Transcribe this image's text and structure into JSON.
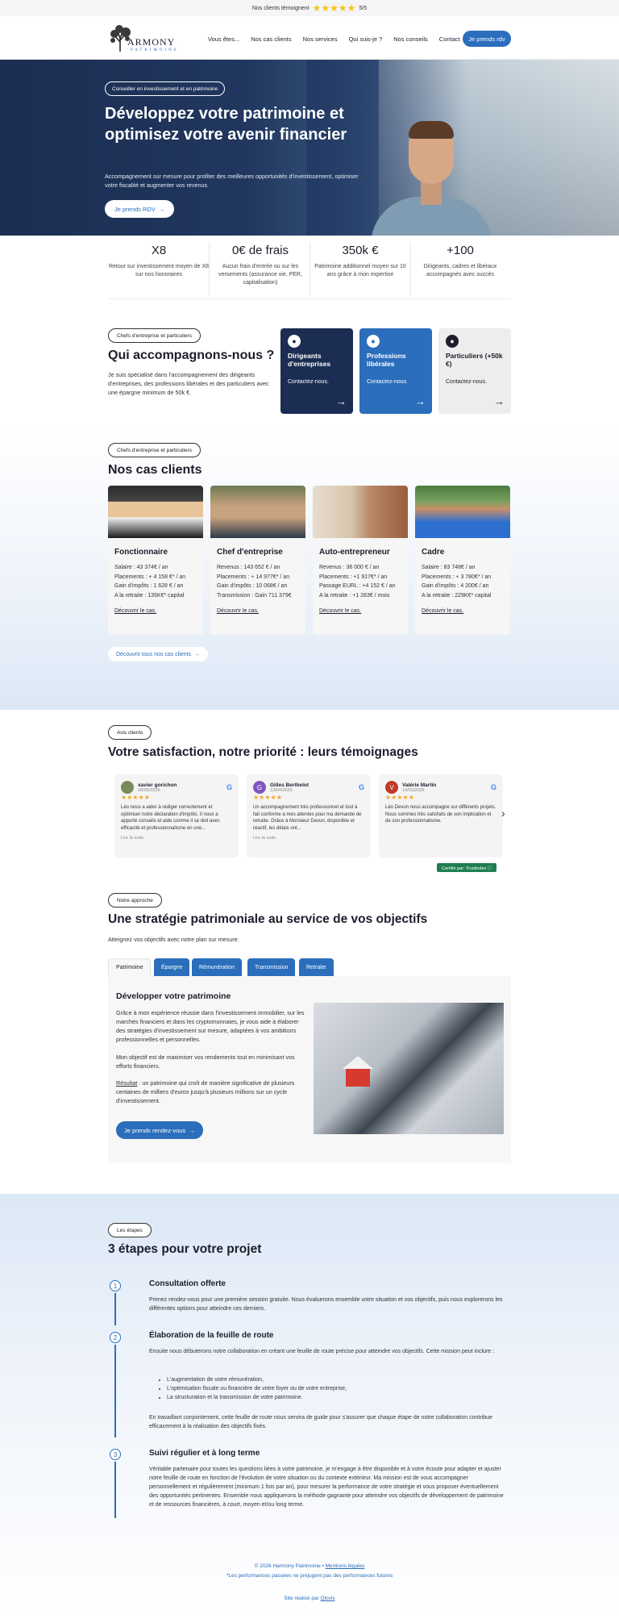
{
  "topbar": {
    "label": "Nos clients témoignent",
    "stars": "★★★★★",
    "score": "5/5"
  },
  "nav": {
    "logo_main": "ARMONY",
    "logo_sub": "PATRIMOINE",
    "links": [
      "Vous êtes...",
      "Nos cas clients",
      "Nos services",
      "Qui suis-je ?",
      "Nos conseils",
      "Contact"
    ],
    "cta": "Je prends rdv"
  },
  "hero": {
    "badge": "Conseiller en investissement et en patrimoine",
    "title": "Développez votre patrimoine et optimisez votre avenir financier",
    "subtitle": "Accompagnement sur mesure pour profiter des meilleures opportunités d'investissement, optimiser votre fiscalité et augmenter vos revenus.",
    "cta": "Je prends RDV",
    "arrow": "→"
  },
  "stats": [
    {
      "value": "X8",
      "desc": "Retour sur investissement moyen de X8 sur nos honoraires"
    },
    {
      "value": "0€ de frais",
      "desc": "Aucun frais d'entrée ou sur les versements (assurance vie, PER, capitalisation)"
    },
    {
      "value": "350k €",
      "desc": "Patrimoine additionnel moyen sur 10 ans grâce à mon expertise"
    },
    {
      "value": "+100",
      "desc": "Dirigeants, cadres et libéraux accompagnés avec succès"
    }
  ],
  "accompany": {
    "pill": "Chefs d'entreprise et particuliers",
    "title": "Qui accompagnons-nous ?",
    "text": "Je suis spécialisé dans l'accompagnement des dirigeants d'entreprises, des professions libérales et des particuliers avec une épargne minimum de 50k €.",
    "cards": [
      {
        "title": "Dirigeants d'entreprises",
        "link": "Contactez-nous.",
        "arrow": "→"
      },
      {
        "title": "Professions libérales",
        "link": "Contactez-nous.",
        "arrow": "→"
      },
      {
        "title": "Particuliers (+50k €)",
        "link": "Contactez-nous.",
        "arrow": "→"
      }
    ]
  },
  "cases": {
    "pill": "Chefs d'entreprise et particuliers",
    "title": "Nos cas clients",
    "items": [
      {
        "title": "Fonctionnaire",
        "lines": [
          "Salaire : 43 374€ / an",
          "Placements : + 4 158 €* / an",
          "Gain d'impôts : 1 628 € / an",
          "A la retraite : 135K€* capital"
        ],
        "link": "Découvrir le cas."
      },
      {
        "title": "Chef d'entreprise",
        "lines": [
          "Revenus : 143 652 € / an",
          "Placements : + 14 977€* / an",
          "Gain d'impôts : 10 068€ / an",
          "Transmission : Gain 711 379€"
        ],
        "link": "Découvrir le cas."
      },
      {
        "title": "Auto-entrepreneur",
        "lines": [
          "Revenus : 36 000 € / an",
          "Placements : +1 917€* / an",
          "Passage EURL : +4 152 € / an",
          "A la retraite : +1 283€ / mois"
        ],
        "link": "Découvrir le cas."
      },
      {
        "title": "Cadre",
        "lines": [
          "Salaire : 83 748€ / an",
          "Placements : + 3 780€* / an",
          "Gain d'impôts : 4 200€ / an",
          "A la retraite : 229K€* capital"
        ],
        "link": "Découvrir le cas."
      }
    ],
    "all_link": "Découvrir tous nos cas clients",
    "arrow": "→"
  },
  "reviews": {
    "pill": "Avis clients",
    "title": "Votre satisfaction, notre priorité : leurs témoignages",
    "items": [
      {
        "name": "xavier gorichon",
        "date": "28/05/2026",
        "initial": "",
        "text": "Léo nous a aider à rédiger correctement et optimiser notre déclaration d'impôts. Il nous a apporté conseils et aide comme il se doit avec efficacité et professionnalisme en une...",
        "more": "Lire la suite",
        "avatar_color": "#7a8a5c"
      },
      {
        "name": "Gilles Berthelot",
        "date": "13/04/2026",
        "initial": "G",
        "text": "Un accompagnement très professionnel et tout à fait conforme à mes attentes pour ma demande de retraite. Grâce à Monsieur Devun, disponible et réactif, les délais ont...",
        "more": "Lire la suite",
        "avatar_color": "#7e57c2"
      },
      {
        "name": "Valérie Martin",
        "date": "14/03/2026",
        "initial": "V",
        "text": "Léo Devun nous accompagne sur différents projets. Nous sommes très satisfaits de son implication et de son professionnalisme.",
        "more": "",
        "avatar_color": "#c0392b"
      }
    ],
    "stars": "★★★★★",
    "google": "G",
    "next": "›",
    "badge": "Certifié par: Trustindex ⓘ"
  },
  "approach": {
    "pill": "Notre approche",
    "title": "Une stratégie patrimoniale au service de vos objectifs",
    "subtitle": "Atteignez vos objectifs avec notre plan sur mesure.",
    "tabs": [
      "Patrimoine",
      "Épargne",
      "Rémunération",
      "Transmission",
      "Retraite"
    ],
    "panel_title": "Développer votre patrimoine",
    "p1": "Grâce à mon expérience réussie dans l'investissement immobilier, sur les marchés financiers et dans les cryptomonnaies, je vous aide à élaborer des stratégies d'investissement sur mesure, adaptées à vos ambitions professionnelles et personnelles.",
    "p2": "Mon objectif est de maximiser vos rendements tout en minimisant vos efforts financiers.",
    "result_label": "Résultat",
    "p3": " : un patrimoine qui croît de manière significative de plusieurs centaines de milliers d'euros jusqu'à plusieurs millions sur un cycle d'investissement.",
    "cta": "Je prends rendez-vous",
    "arrow": "→"
  },
  "steps": {
    "pill": "Les étapes",
    "title": "3 étapes pour votre projet",
    "items": [
      {
        "num": "1",
        "title": "Consultation offerte",
        "text": "Prenez rendez-vous pour une première session gratuite. Nous évaluerons ensemble votre situation et vos objectifs, puis nous explorerons les différentes options pour atteindre ces derniers."
      },
      {
        "num": "2",
        "title": "Élaboration de la feuille de route",
        "text": "Ensuite nous débuterons notre collaboration en créant une feuille de route précise pour atteindre vos objectifs. Cette mission peut inclure :",
        "bullets": [
          "L'augmentation de votre rémunération,",
          "L'optimisation fiscale ou financière de votre foyer ou de votre entreprise,",
          "La structuration et la transmission de votre patrimoine."
        ],
        "text2": "En travaillant conjointement, cette feuille de route nous servira de guide pour s'assurer que chaque étape de notre collaboration contribue efficacement à la réalisation des objectifs fixés."
      },
      {
        "num": "3",
        "title": "Suivi régulier et à long terme",
        "text": "Véritable partenaire pour toutes les questions liées à votre patrimoine, je m'engage à être disponible et à votre écoute pour adapter et ajuster notre feuille de route en fonction de l'évolution de votre situation ou du contexte extérieur. Ma mission est de vous accompagner personnellement et régulièrement (minimum 1 fois par an), pour mesurer la performance de votre stratégie et vous proposer éventuellement des opportunités pertinentes. Ensemble nous appliquerons la méthode gagnante pour atteindre vos objectifs de développement de patrimoine et de ressources financières, à court, moyen et/ou long terme."
      }
    ]
  },
  "footer": {
    "copyright": "© 2026 Harmony Patrimoine •",
    "legal": "Mentions légales",
    "disclaimer": "*Les performances passées ne préjugent pas des performances futures",
    "made_by": "Site réalisé par",
    "made_by_link": "Qlovis"
  }
}
